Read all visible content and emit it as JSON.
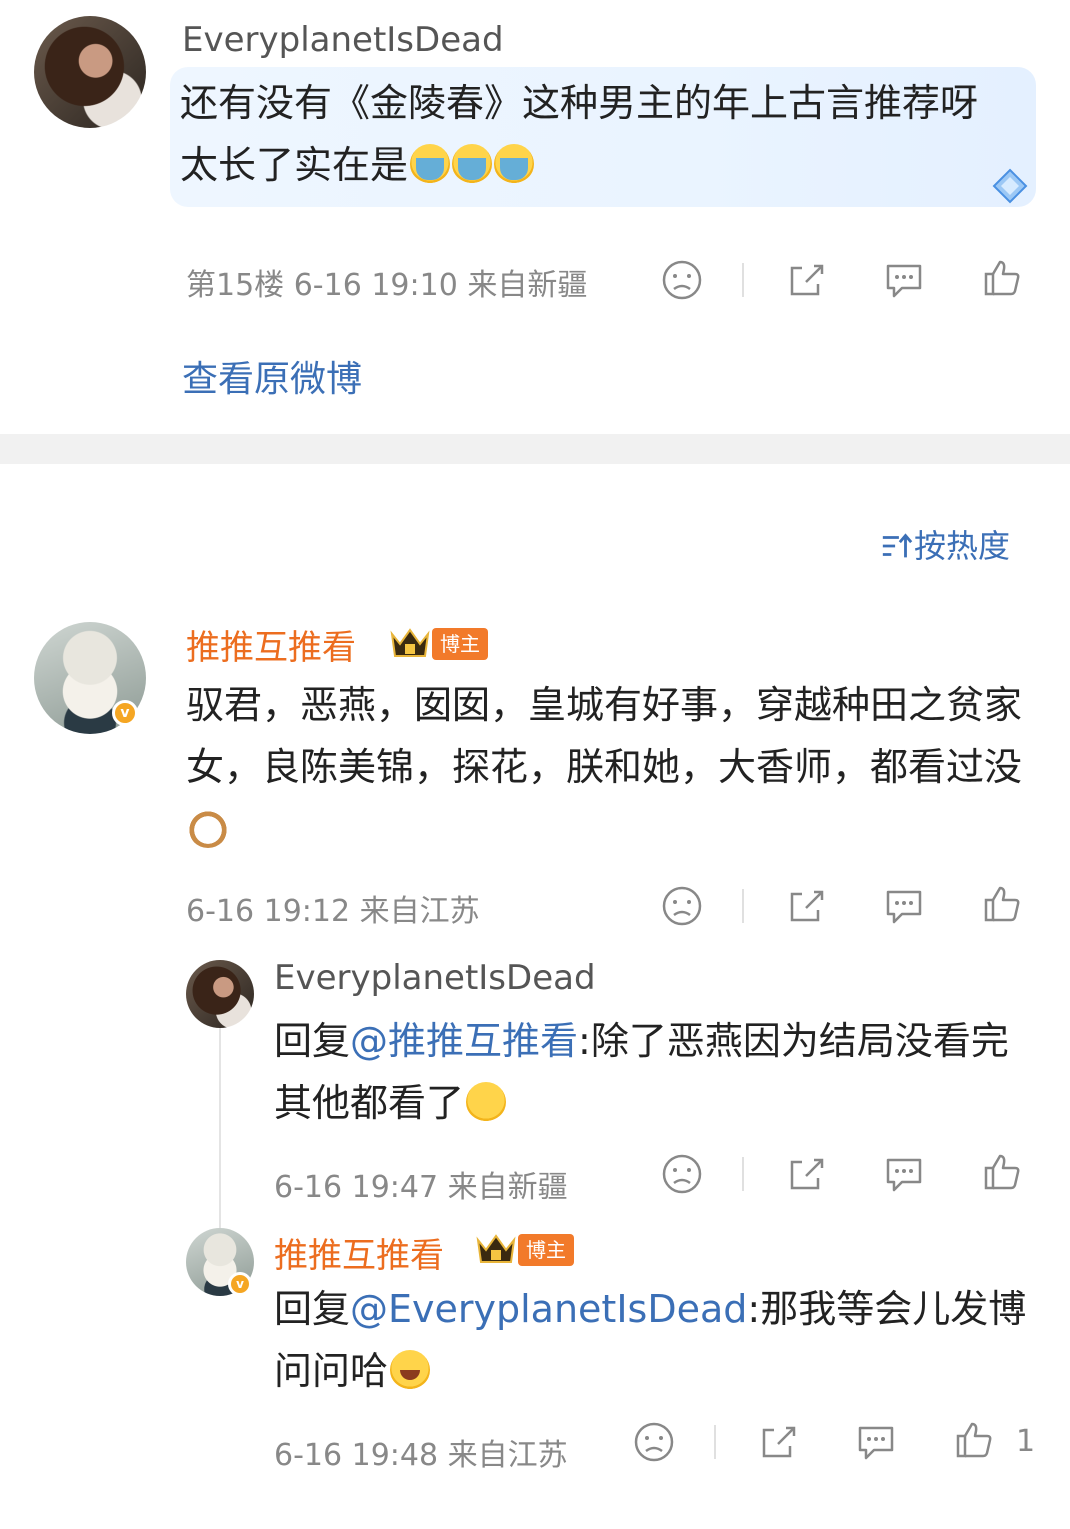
{
  "top_comment": {
    "username": "EveryplanetIsDead",
    "text": "还有没有《金陵春》这种男主的年上古言推荐呀 太长了实在是",
    "emojis": [
      "crying-emoji",
      "crying-emoji",
      "crying-emoji"
    ],
    "meta": "第15楼 6-16 19:10 来自新疆",
    "view_original": "查看原微博"
  },
  "sort": {
    "label": "按热度",
    "icon": "sort-icon"
  },
  "comment": {
    "username": "推推互推看",
    "badge": "博主",
    "text": "驭君，恶燕，囡囡，皇城有好事，穿越种田之贫家女，良陈美锦，探花，朕和她，大香师，都看过没",
    "emoji": "cat-emoji",
    "meta": "6-16 19:12 来自江苏"
  },
  "reply1": {
    "username": "EveryplanetIsDead",
    "prefix": "回复",
    "mention": "@推推互推看",
    "text": ":除了恶燕因为结局没看完 其他都看了",
    "emoji": "covering-face-emoji",
    "meta": "6-16 19:47 来自新疆"
  },
  "reply2": {
    "username": "推推互推看",
    "badge": "博主",
    "prefix": "回复",
    "mention": "@EveryplanetIsDead",
    "text": ":那我等会儿发博问问哈",
    "emoji": "laughing-emoji",
    "meta": "6-16 19:48 来自江苏",
    "like_count": "1"
  },
  "colors": {
    "accent_blue": "#3b6fb6",
    "vip_orange": "#ec6d1f",
    "meta_gray": "#888888"
  }
}
